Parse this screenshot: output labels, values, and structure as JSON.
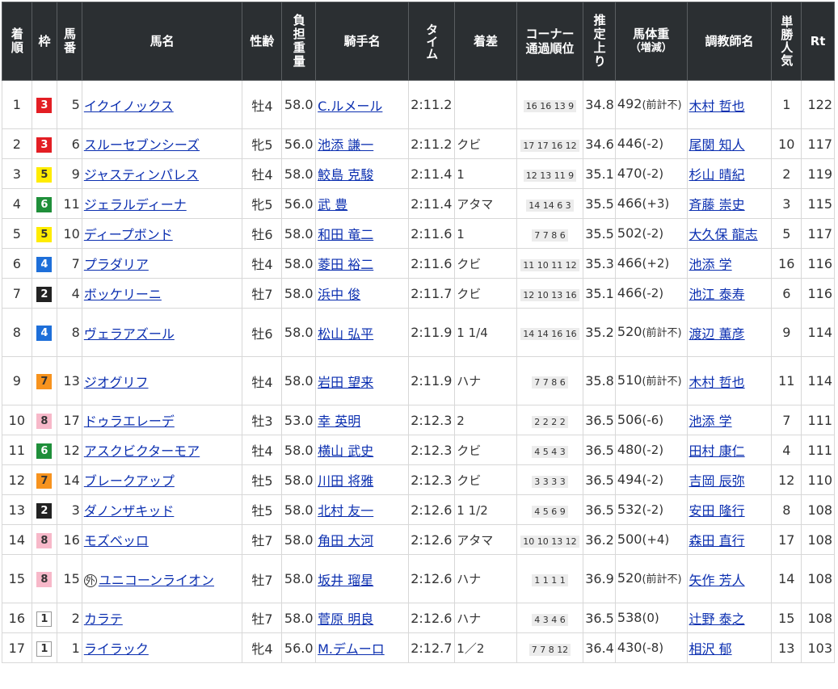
{
  "headers": {
    "rank": "着順",
    "waku": "枠",
    "umaban": "馬番",
    "horse": "馬名",
    "sexage": "性齢",
    "weight": "負担重量",
    "jockey": "騎手名",
    "time": "タイム",
    "margin": "着差",
    "corner_l1": "コーナー",
    "corner_l2": "通過順位",
    "last": "推定上り",
    "bw_l1": "馬体重",
    "bw_l2": "（増減）",
    "trainer": "調教師名",
    "pop": "単勝人気",
    "rt": "Rt"
  },
  "rows": [
    {
      "rank": "1",
      "waku": "3",
      "umaban": "5",
      "horse": "イクイノックス",
      "tag": "",
      "sexage": "牡4",
      "weight": "58.0",
      "jockey": "C.ルメール",
      "time": "2:11.2",
      "margin": "",
      "corner": "16 16 13 9",
      "last": "34.8",
      "bw": "492",
      "bw_chg": "(前計不)",
      "trainer": "木村 哲也",
      "pop": "1",
      "rt": "122"
    },
    {
      "rank": "2",
      "waku": "3",
      "umaban": "6",
      "horse": "スルーセブンシーズ",
      "tag": "",
      "sexage": "牝5",
      "weight": "56.0",
      "jockey": "池添 謙一",
      "time": "2:11.2",
      "margin": "クビ",
      "corner": "17 17 16 12",
      "last": "34.6",
      "bw": "446",
      "bw_chg": "(-2)",
      "trainer": "尾関 知人",
      "pop": "10",
      "rt": "117"
    },
    {
      "rank": "3",
      "waku": "5",
      "umaban": "9",
      "horse": "ジャスティンパレス",
      "tag": "",
      "sexage": "牡4",
      "weight": "58.0",
      "jockey": "鮫島 克駿",
      "time": "2:11.4",
      "margin": "1",
      "corner": "12 13 11 9",
      "last": "35.1",
      "bw": "470",
      "bw_chg": "(-2)",
      "trainer": "杉山 晴紀",
      "pop": "2",
      "rt": "119"
    },
    {
      "rank": "4",
      "waku": "6",
      "umaban": "11",
      "horse": "ジェラルディーナ",
      "tag": "",
      "sexage": "牝5",
      "weight": "56.0",
      "jockey": "武 豊",
      "time": "2:11.4",
      "margin": "アタマ",
      "corner": "14 14 6 3",
      "last": "35.5",
      "bw": "466",
      "bw_chg": "(+3)",
      "trainer": "斉藤 崇史",
      "pop": "3",
      "rt": "115"
    },
    {
      "rank": "5",
      "waku": "5",
      "umaban": "10",
      "horse": "ディープボンド",
      "tag": "",
      "sexage": "牡6",
      "weight": "58.0",
      "jockey": "和田 竜二",
      "time": "2:11.6",
      "margin": "1",
      "corner": "7 7 8 6",
      "last": "35.5",
      "bw": "502",
      "bw_chg": "(-2)",
      "trainer": "大久保 龍志",
      "pop": "5",
      "rt": "117"
    },
    {
      "rank": "6",
      "waku": "4",
      "umaban": "7",
      "horse": "プラダリア",
      "tag": "",
      "sexage": "牡4",
      "weight": "58.0",
      "jockey": "菱田 裕二",
      "time": "2:11.6",
      "margin": "クビ",
      "corner": "11 10 11 12",
      "last": "35.3",
      "bw": "466",
      "bw_chg": "(+2)",
      "trainer": "池添 学",
      "pop": "16",
      "rt": "116"
    },
    {
      "rank": "7",
      "waku": "2",
      "umaban": "4",
      "horse": "ボッケリーニ",
      "tag": "",
      "sexage": "牡7",
      "weight": "58.0",
      "jockey": "浜中 俊",
      "time": "2:11.7",
      "margin": "クビ",
      "corner": "12 10 13 16",
      "last": "35.1",
      "bw": "466",
      "bw_chg": "(-2)",
      "trainer": "池江 泰寿",
      "pop": "6",
      "rt": "116"
    },
    {
      "rank": "8",
      "waku": "4",
      "umaban": "8",
      "horse": "ヴェラアズール",
      "tag": "",
      "sexage": "牡6",
      "weight": "58.0",
      "jockey": "松山 弘平",
      "time": "2:11.9",
      "margin": "1 1/4",
      "corner": "14 14 16 16",
      "last": "35.2",
      "bw": "520",
      "bw_chg": "(前計不)",
      "trainer": "渡辺 薫彦",
      "pop": "9",
      "rt": "114"
    },
    {
      "rank": "9",
      "waku": "7",
      "umaban": "13",
      "horse": "ジオグリフ",
      "tag": "",
      "sexage": "牡4",
      "weight": "58.0",
      "jockey": "岩田 望来",
      "time": "2:11.9",
      "margin": "ハナ",
      "corner": "7 7 8 6",
      "last": "35.8",
      "bw": "510",
      "bw_chg": "(前計不)",
      "trainer": "木村 哲也",
      "pop": "11",
      "rt": "114"
    },
    {
      "rank": "10",
      "waku": "8",
      "umaban": "17",
      "horse": "ドゥラエレーデ",
      "tag": "",
      "sexage": "牡3",
      "weight": "53.0",
      "jockey": "幸 英明",
      "time": "2:12.3",
      "margin": "2",
      "corner": "2 2 2 2",
      "last": "36.5",
      "bw": "506",
      "bw_chg": "(-6)",
      "trainer": "池添 学",
      "pop": "7",
      "rt": "111"
    },
    {
      "rank": "11",
      "waku": "6",
      "umaban": "12",
      "horse": "アスクビクターモア",
      "tag": "",
      "sexage": "牡4",
      "weight": "58.0",
      "jockey": "横山 武史",
      "time": "2:12.3",
      "margin": "クビ",
      "corner": "4 5 4 3",
      "last": "36.5",
      "bw": "480",
      "bw_chg": "(-2)",
      "trainer": "田村 康仁",
      "pop": "4",
      "rt": "111"
    },
    {
      "rank": "12",
      "waku": "7",
      "umaban": "14",
      "horse": "ブレークアップ",
      "tag": "",
      "sexage": "牡5",
      "weight": "58.0",
      "jockey": "川田 将雅",
      "time": "2:12.3",
      "margin": "クビ",
      "corner": "3 3 3 3",
      "last": "36.5",
      "bw": "494",
      "bw_chg": "(-2)",
      "trainer": "吉岡 辰弥",
      "pop": "12",
      "rt": "110"
    },
    {
      "rank": "13",
      "waku": "2",
      "umaban": "3",
      "horse": "ダノンザキッド",
      "tag": "",
      "sexage": "牡5",
      "weight": "58.0",
      "jockey": "北村 友一",
      "time": "2:12.6",
      "margin": "1 1/2",
      "corner": "4 5 6 9",
      "last": "36.5",
      "bw": "532",
      "bw_chg": "(-2)",
      "trainer": "安田 隆行",
      "pop": "8",
      "rt": "108"
    },
    {
      "rank": "14",
      "waku": "8",
      "umaban": "16",
      "horse": "モズベッロ",
      "tag": "",
      "sexage": "牡7",
      "weight": "58.0",
      "jockey": "角田 大河",
      "time": "2:12.6",
      "margin": "アタマ",
      "corner": "10 10 13 12",
      "last": "36.2",
      "bw": "500",
      "bw_chg": "(+4)",
      "trainer": "森田 直行",
      "pop": "17",
      "rt": "108"
    },
    {
      "rank": "15",
      "waku": "8",
      "umaban": "15",
      "horse": "ユニコーンライオン",
      "tag": "外",
      "sexage": "牡7",
      "weight": "58.0",
      "jockey": "坂井 瑠星",
      "time": "2:12.6",
      "margin": "ハナ",
      "corner": "1 1 1 1",
      "last": "36.9",
      "bw": "520",
      "bw_chg": "(前計不)",
      "trainer": "矢作 芳人",
      "pop": "14",
      "rt": "108"
    },
    {
      "rank": "16",
      "waku": "1",
      "umaban": "2",
      "horse": "カラテ",
      "tag": "",
      "sexage": "牡7",
      "weight": "58.0",
      "jockey": "菅原 明良",
      "time": "2:12.6",
      "margin": "ハナ",
      "corner": "4 3 4 6",
      "last": "36.5",
      "bw": "538",
      "bw_chg": "(0)",
      "trainer": "辻野 泰之",
      "pop": "15",
      "rt": "108"
    },
    {
      "rank": "17",
      "waku": "1",
      "umaban": "1",
      "horse": "ライラック",
      "tag": "",
      "sexage": "牝4",
      "weight": "56.0",
      "jockey": "M.デムーロ",
      "time": "2:12.7",
      "margin": "1／2",
      "corner": "7 7 8 12",
      "last": "36.4",
      "bw": "430",
      "bw_chg": "(-8)",
      "trainer": "相沢 郁",
      "pop": "13",
      "rt": "103"
    }
  ]
}
